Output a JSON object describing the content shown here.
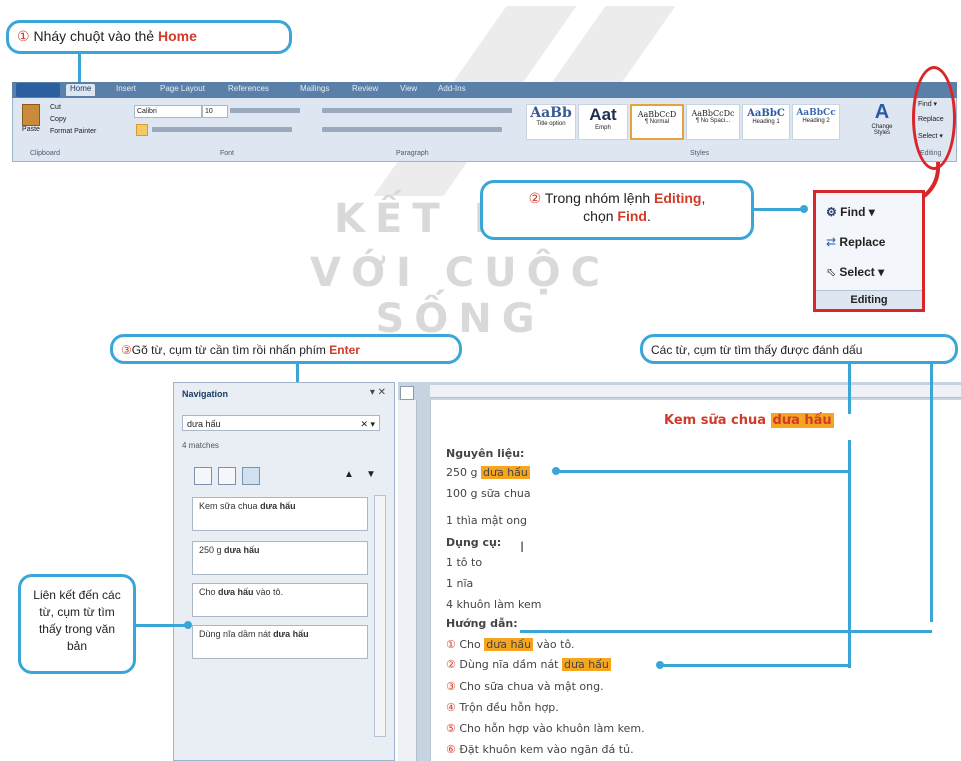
{
  "watermark": {
    "line1": "KẾT NỐI",
    "line2": "VỚI CUỘC SỐNG"
  },
  "callouts": {
    "step1": {
      "num": "①",
      "text": "Nháy chuột vào thẻ ",
      "highlight": "Home"
    },
    "step2": {
      "num": "②",
      "text_a": "Trong nhóm lệnh ",
      "highlight_a": "Editing",
      "text_b": ",",
      "text_c": "chọn ",
      "highlight_b": "Find",
      "text_d": "."
    },
    "step3": {
      "num": "③",
      "text": "Gõ từ, cụm từ cần tìm rồi nhấn phím ",
      "highlight": "Enter"
    },
    "found": {
      "text": "Các từ, cụm từ tìm thấy được đánh dấu"
    },
    "links": {
      "text": "Liên kết đến các từ, cụm từ tìm thấy trong văn bản"
    }
  },
  "ribbon": {
    "tabs": [
      "Home",
      "Insert",
      "Page Layout",
      "References",
      "Mailings",
      "Review",
      "View",
      "Add-Ins"
    ],
    "groups": [
      "Clipboard",
      "Font",
      "Paragraph",
      "Styles",
      "Editing"
    ],
    "clipboard": {
      "paste": "Paste",
      "cut": "Cut",
      "copy": "Copy",
      "format_painter": "Format Painter"
    },
    "font": {
      "name": "Calibri",
      "size": "10"
    },
    "styles": [
      {
        "preview": "AaBb",
        "name": "Title option"
      },
      {
        "preview": "Aat",
        "name": "Emph"
      },
      {
        "preview": "AaBbCcD",
        "name": "¶ Normal"
      },
      {
        "preview": "AaBbCcDc",
        "name": "¶ No Spaci..."
      },
      {
        "preview": "AaBbC",
        "name": "Heading 1"
      },
      {
        "preview": "AaBbCc",
        "name": "Heading 2"
      }
    ],
    "change_styles": "Change Styles",
    "mini_editing": [
      "Find ▾",
      "Replace",
      "Select ▾"
    ]
  },
  "editing_panel": {
    "find": "Find ▾",
    "replace": "Replace",
    "select": "Select ▾",
    "group_label": "Editing"
  },
  "navigation": {
    "title": "Navigation",
    "search_value": "dưa hấu",
    "matches": "4 matches",
    "results": [
      {
        "pre": "Kem sữa chua ",
        "match": "dưa hấu",
        "post": ""
      },
      {
        "pre": "250 g ",
        "match": "dưa hấu",
        "post": ""
      },
      {
        "pre": "Cho ",
        "match": "dưa hấu",
        "post": " vào tô."
      },
      {
        "pre": "Dùng nĩa dầm nát ",
        "match": "dưa hấu",
        "post": ""
      }
    ]
  },
  "document": {
    "title_pre": "Kem sữa chua ",
    "title_match": "dưa hấu",
    "ingredients_heading": "Nguyên liệu:",
    "ingredient1_pre": "250 g ",
    "ingredient1_match": "dưa hấu",
    "ingredient2": "100 g sữa chua",
    "ingredient3": "1 thìa mật ong",
    "tools_heading": "Dụng cụ:",
    "tool1": "1 tô to",
    "tool2": "1 nĩa",
    "tool3": "4 khuôn làm kem",
    "steps_heading": "Hướng dẫn:",
    "steps": [
      {
        "num": "①",
        "pre": "Cho ",
        "match": "dưa hấu",
        "post": " vào tô."
      },
      {
        "num": "②",
        "pre": "Dùng nĩa dầm nát ",
        "match": "dưa hấu",
        "post": ""
      },
      {
        "num": "③",
        "pre": "Cho sữa chua và mật ong.",
        "match": "",
        "post": ""
      },
      {
        "num": "④",
        "pre": "Trộn đều hỗn hợp.",
        "match": "",
        "post": ""
      },
      {
        "num": "⑤",
        "pre": "Cho hỗn hợp vào khuôn làm kem.",
        "match": "",
        "post": ""
      },
      {
        "num": "⑥",
        "pre": "Đặt khuôn kem vào ngăn đá tủ.",
        "match": "",
        "post": ""
      }
    ]
  },
  "colors": {
    "callout_border": "#3aa6d8",
    "accent_red": "#d23b2a",
    "highlight": "#f5a51f",
    "editing_border": "#d9262a"
  }
}
